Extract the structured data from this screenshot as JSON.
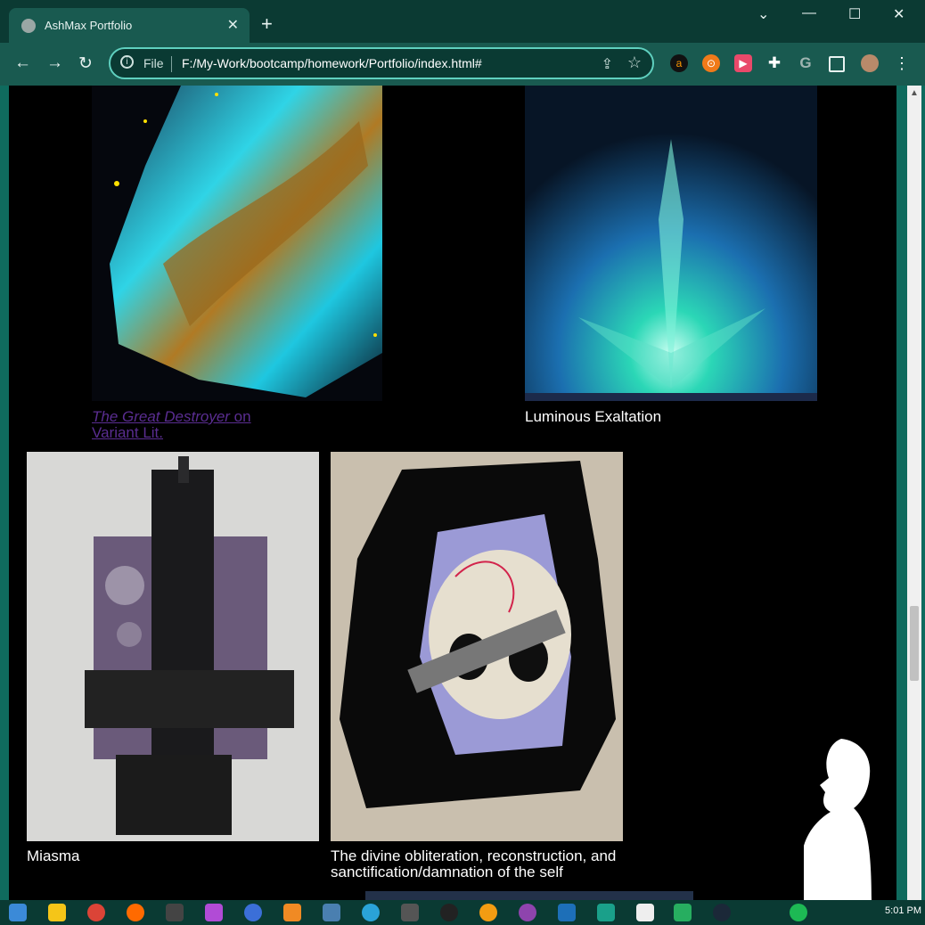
{
  "browser": {
    "tab_title": "AshMax Portfolio",
    "tab_close": "✕",
    "new_tab": "+",
    "window_controls": {
      "minimize": "—",
      "maximize": "☐",
      "close": "✕",
      "dropdown": "⌄"
    },
    "nav": {
      "back": "←",
      "forward": "→",
      "reload": "↻"
    },
    "address": {
      "scheme_label": "File",
      "url": "F:/My-Work/bootcamp/homework/Portfolio/index.html#"
    },
    "extension_icons": [
      "amazon-icon",
      "avast-icon",
      "screen-record-icon",
      "puzzle-extensions-icon",
      "grammarly-icon",
      "sidepanel-icon",
      "profile-avatar"
    ],
    "menu": "⋮"
  },
  "gallery": {
    "items": [
      {
        "title_em": "The Great Destroyer",
        "title_rest": " on",
        "title_line2": "Variant Lit.",
        "is_link": true
      },
      {
        "title": "Luminous Exaltation"
      },
      {
        "title": "Miasma"
      },
      {
        "title_line1": "The divine obliteration, reconstruction, and",
        "title_line2": "sanctification/damnation of the self"
      }
    ]
  },
  "taskbar": {
    "time": "5:01 PM"
  },
  "colors": {
    "accent": "#0f6b5e",
    "chrome_dark": "#0b3a33",
    "toolbar": "#195a50",
    "link_visited": "#5a2d91"
  }
}
